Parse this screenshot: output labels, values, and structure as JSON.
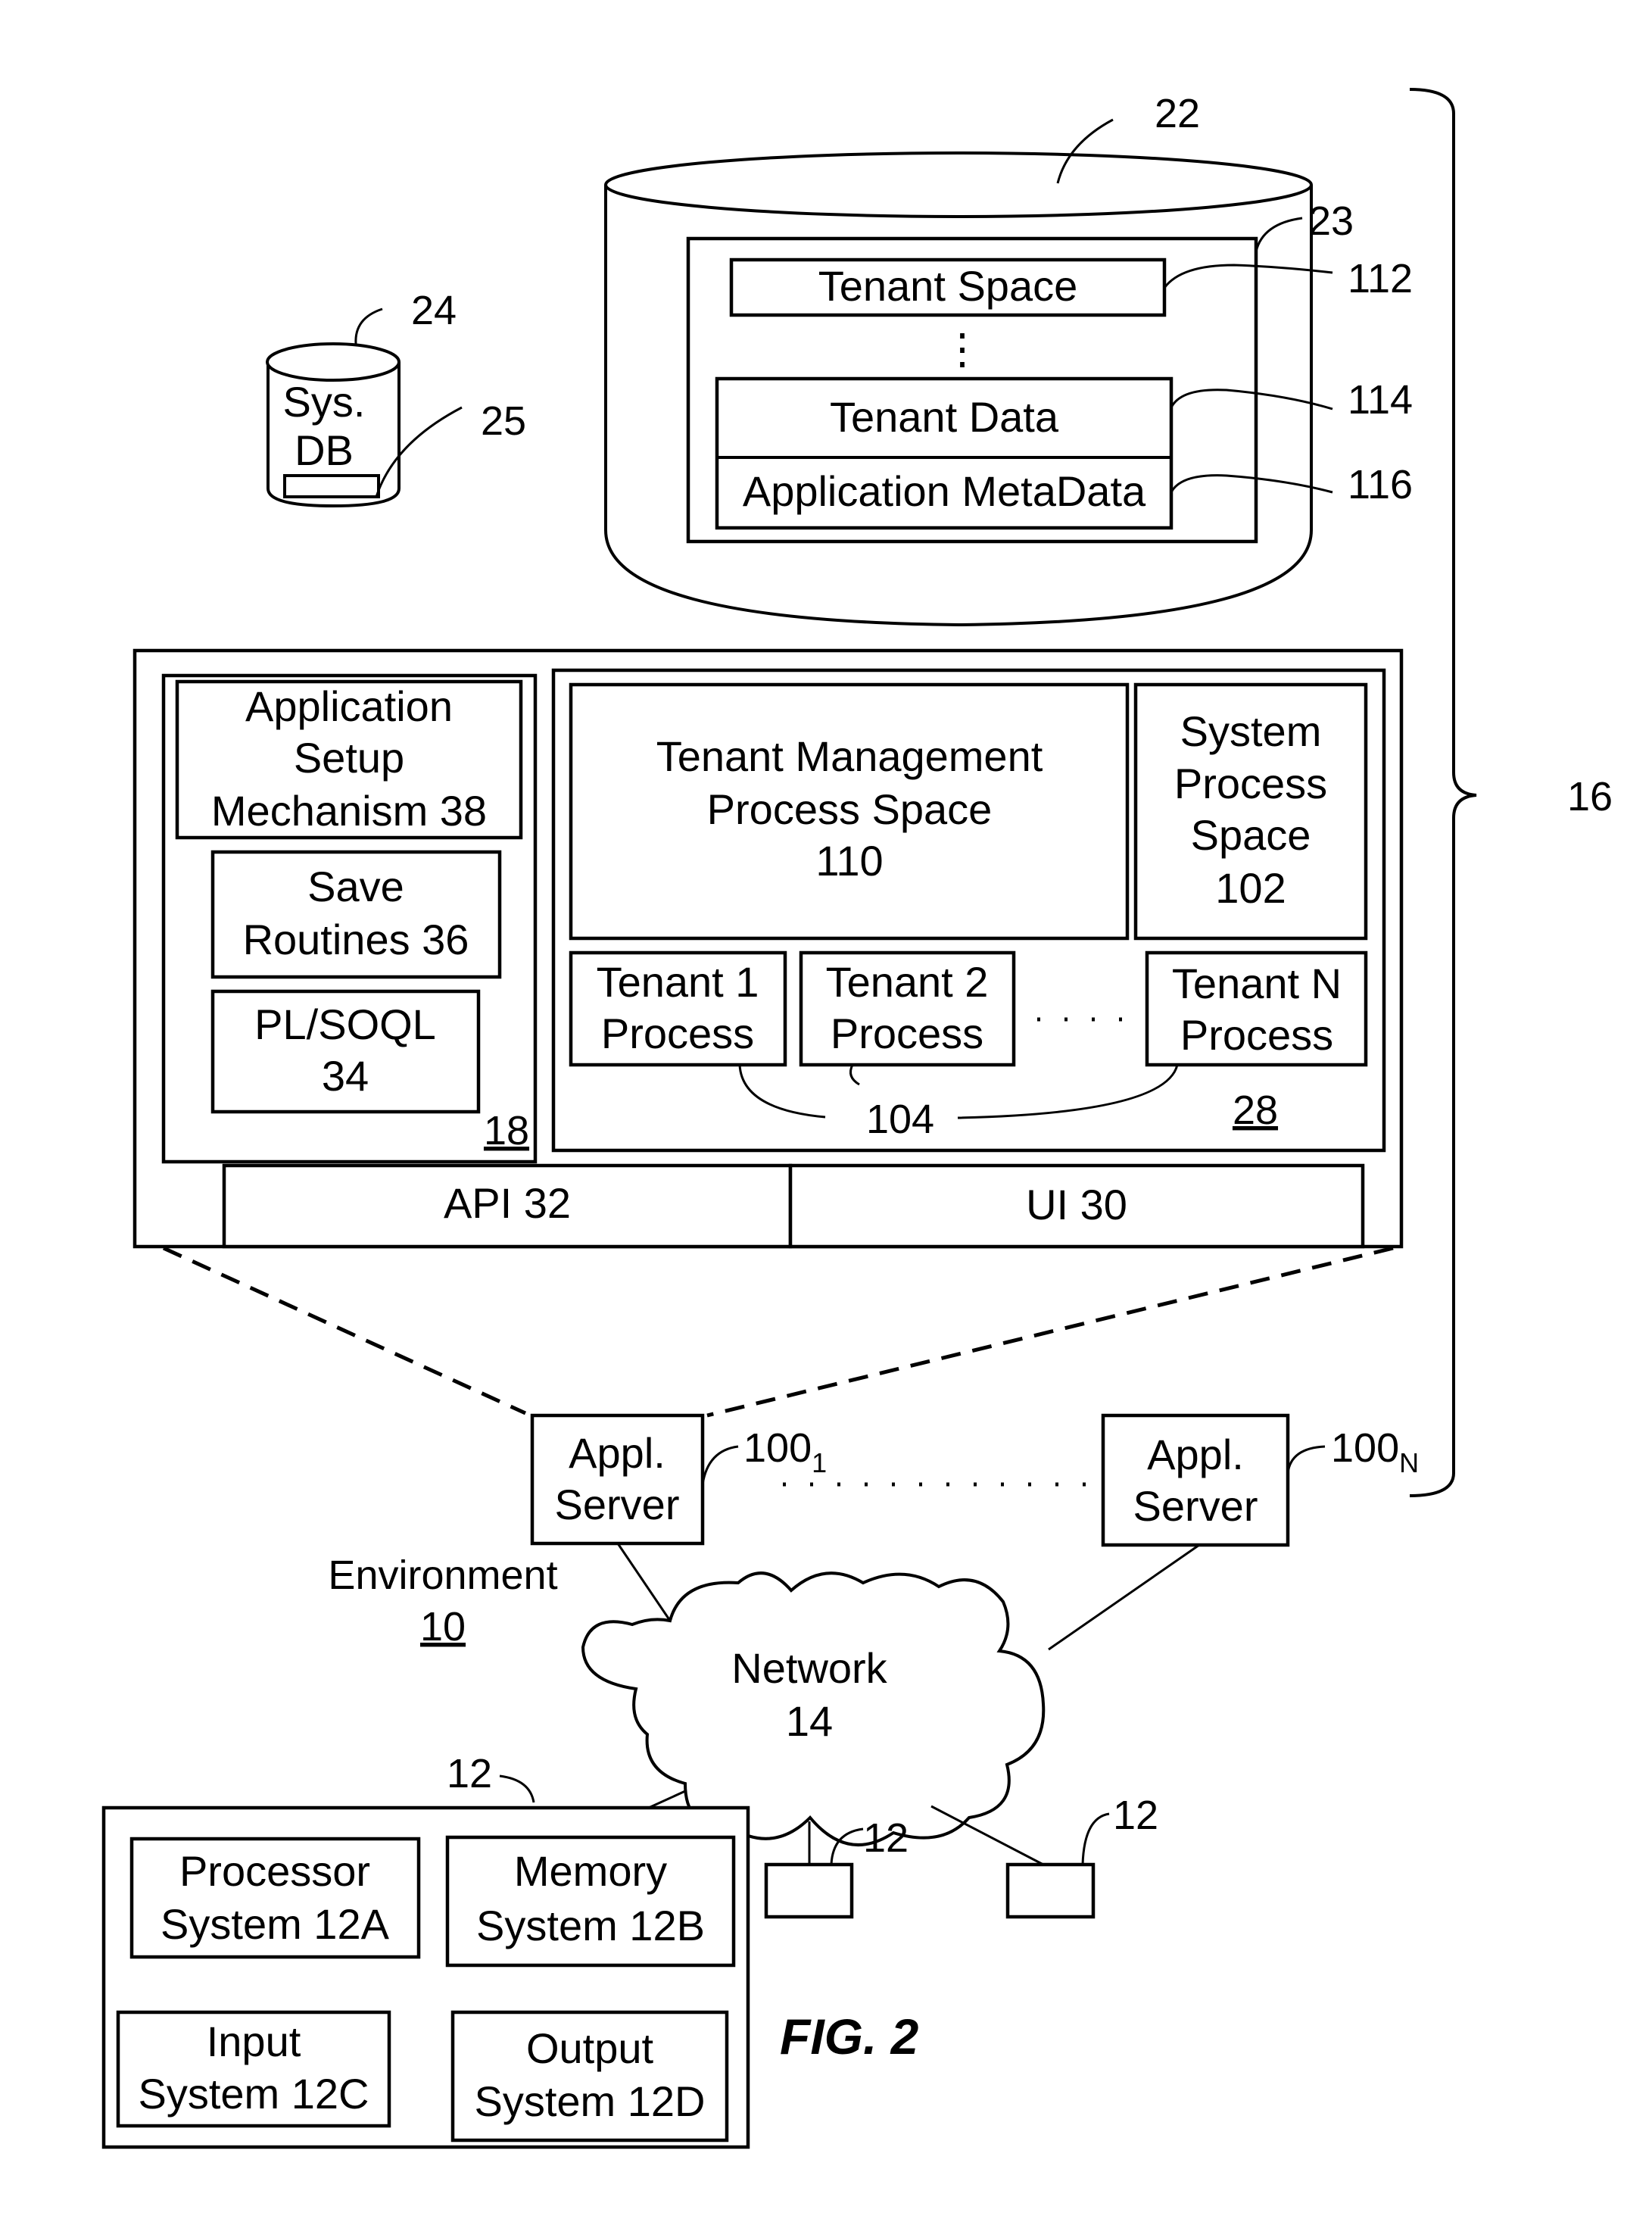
{
  "figure": {
    "title": "FIG. 2",
    "environment": {
      "label": "Environment",
      "ref": "10"
    },
    "system_ref": "16",
    "tenant_db": {
      "ref": "22",
      "storage_ref": "23",
      "tenant_space": {
        "label": "Tenant Space",
        "ref": "112"
      },
      "ellipsis": "⋮",
      "tenant_data": {
        "label": "Tenant Data",
        "ref": "114"
      },
      "app_metadata": {
        "label": "Application MetaData",
        "ref": "116"
      }
    },
    "system_db": {
      "label_line1": "Sys.",
      "label_line2": "DB",
      "ref": "24",
      "storage_ref": "25"
    },
    "app_platform": {
      "ref": "18",
      "setup": {
        "line1": "Application",
        "line2": "Setup",
        "line3": "Mechanism 38"
      },
      "save": {
        "line1": "Save",
        "line2": "Routines 36"
      },
      "plsoql": {
        "line1": "PL/SOQL",
        "line2": "34"
      }
    },
    "process_space": {
      "ref": "28",
      "tenant_mgmt": {
        "line1": "Tenant Management",
        "line2": "Process Space",
        "line3": "110"
      },
      "system_process": {
        "line1": "System",
        "line2": "Process",
        "line3": "Space",
        "line4": "102"
      },
      "tenant1": {
        "line1": "Tenant 1",
        "line2": "Process"
      },
      "tenant2": {
        "line1": "Tenant 2",
        "line2": "Process"
      },
      "ellipsis": "· · · ·",
      "tenantN": {
        "line1": "Tenant N",
        "line2": "Process"
      },
      "tenant_process_ref": "104"
    },
    "interfaces": {
      "api": "API 32",
      "ui": "UI 30"
    },
    "servers": [
      {
        "line1": "Appl.",
        "line2": "Server",
        "ref": "100",
        "ref_sub": "1"
      },
      {
        "line1": "Appl.",
        "line2": "Server",
        "ref": "100",
        "ref_sub": "N"
      }
    ],
    "network": {
      "line1": "Network",
      "line2": "14"
    },
    "user_system": {
      "ref": "12",
      "processor": {
        "line1": "Processor",
        "line2": "System 12A"
      },
      "memory": {
        "line1": "Memory",
        "line2": "System 12B"
      },
      "input": {
        "line1": "Input",
        "line2": "System 12C"
      },
      "output": {
        "line1": "Output",
        "line2": "System 12D"
      }
    },
    "other_user_systems": [
      {
        "ref": "12"
      },
      {
        "ref": "12"
      }
    ]
  }
}
